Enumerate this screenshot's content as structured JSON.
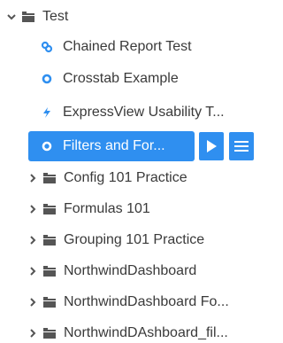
{
  "tree": {
    "root": {
      "label": "Test",
      "expanded": true
    },
    "children": [
      {
        "label": "Chained Report Test",
        "icon": "chained-report-icon"
      },
      {
        "label": "Crosstab Example",
        "icon": "crosstab-icon"
      },
      {
        "label": "ExpressView Usability T...",
        "icon": "expressview-icon"
      }
    ],
    "selected": {
      "label": "Filters and For...",
      "icon": "filter-report-icon",
      "run_icon": "play-icon",
      "menu_icon": "hamburger-menu-icon"
    },
    "folders": [
      {
        "label": "Config 101 Practice"
      },
      {
        "label": "Formulas 101"
      },
      {
        "label": "Grouping 101 Practice"
      },
      {
        "label": "NorthwindDashboard"
      },
      {
        "label": "NorthwindDashboard Fo..."
      },
      {
        "label": "NorthwindDAshboard_fil..."
      }
    ]
  },
  "colors": {
    "accent": "#2f8ff0",
    "text": "#3a3a3a",
    "icon_gray": "#555555"
  }
}
